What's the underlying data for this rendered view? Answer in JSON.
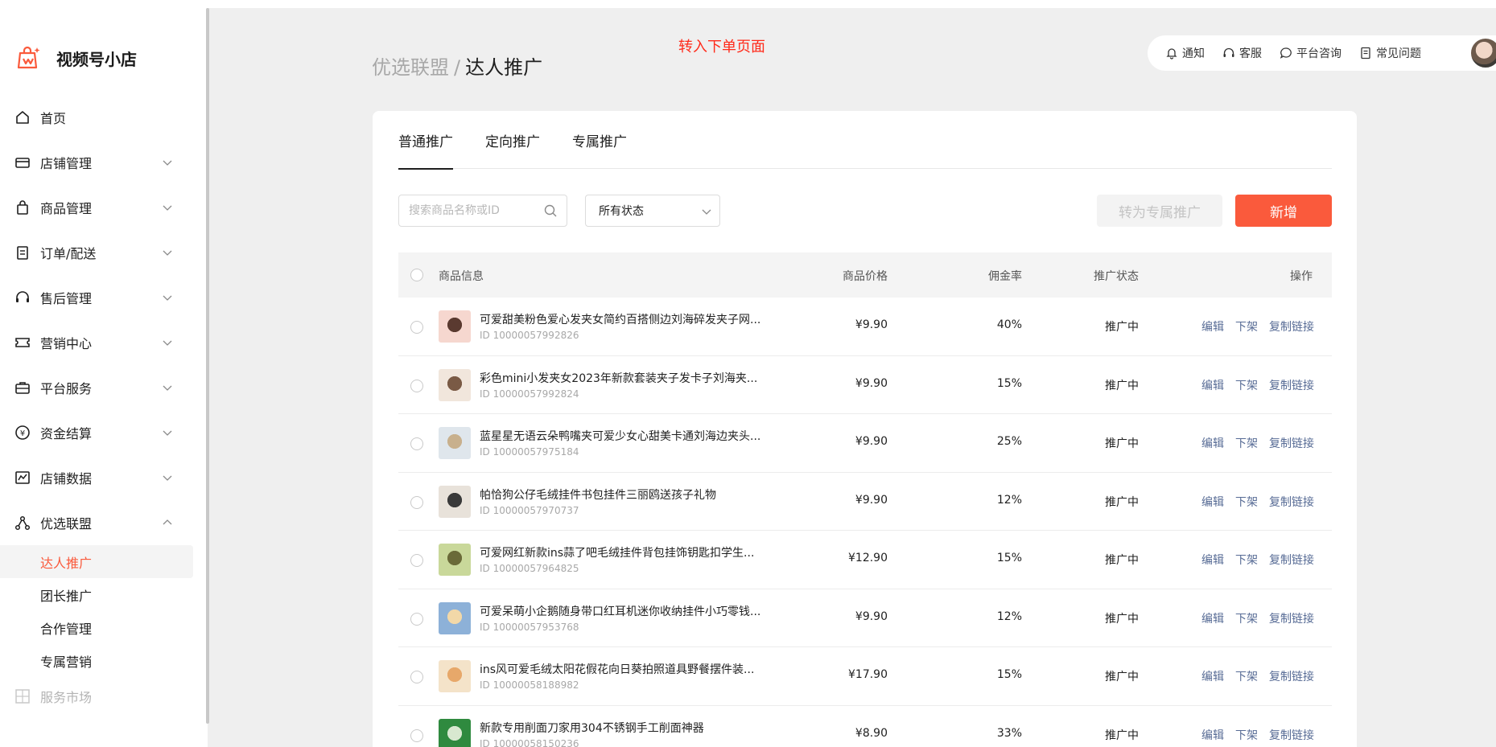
{
  "app": {
    "name": "视频号小店"
  },
  "sidebar": {
    "items": [
      {
        "label": "首页",
        "icon": "home-icon"
      },
      {
        "label": "店铺管理",
        "icon": "store-icon"
      },
      {
        "label": "商品管理",
        "icon": "bag-icon"
      },
      {
        "label": "订单/配送",
        "icon": "clipboard-icon"
      },
      {
        "label": "售后管理",
        "icon": "headset-icon"
      },
      {
        "label": "营销中心",
        "icon": "ticket-icon"
      },
      {
        "label": "平台服务",
        "icon": "briefcase-icon"
      },
      {
        "label": "资金结算",
        "icon": "yuan-icon"
      },
      {
        "label": "店铺数据",
        "icon": "chart-icon"
      },
      {
        "label": "优选联盟",
        "icon": "network-icon"
      }
    ],
    "sub_items": [
      "达人推广",
      "团长推广",
      "合作管理",
      "专属营销"
    ],
    "disabled_item": "服务市场"
  },
  "breadcrumb": {
    "parent": "优选联盟",
    "separator": "/",
    "current": "达人推广"
  },
  "annotation": "转入下单页面",
  "topbar": {
    "notify": "通知",
    "service": "客服",
    "consult": "平台咨询",
    "faq": "常见问题"
  },
  "tabs": [
    "普通推广",
    "定向推广",
    "专属推广"
  ],
  "search": {
    "placeholder": "搜索商品名称或ID",
    "value": ""
  },
  "status_select": {
    "value": "所有状态"
  },
  "buttons": {
    "convert": "转为专属推广",
    "add": "新增"
  },
  "accent_color": "#fa5a3c",
  "table": {
    "headers": {
      "info": "商品信息",
      "price": "商品价格",
      "commission": "佣金率",
      "status": "推广状态",
      "ops": "操作"
    },
    "op_labels": {
      "edit": "编辑",
      "delist": "下架",
      "copy": "复制链接"
    },
    "rows": [
      {
        "name": "可爱甜美粉色爱心发夹女简约百搭侧边刘海碎发夹子网...",
        "id": "ID 10000057992826",
        "price": "¥9.90",
        "commission": "40%",
        "status": "推广中"
      },
      {
        "name": "彩色mini小发夹女2023年新款套装夹子发卡子刘海夹...",
        "id": "ID 10000057992824",
        "price": "¥9.90",
        "commission": "15%",
        "status": "推广中"
      },
      {
        "name": "蓝星星无语云朵鸭嘴夹可爱少女心甜美卡通刘海边夹头...",
        "id": "ID 10000057975184",
        "price": "¥9.90",
        "commission": "25%",
        "status": "推广中"
      },
      {
        "name": "帕恰狗公仔毛绒挂件书包挂件三丽鸥送孩子礼物",
        "id": "ID 10000057970737",
        "price": "¥9.90",
        "commission": "12%",
        "status": "推广中"
      },
      {
        "name": "可爱网红新款ins蒜了吧毛绒挂件背包挂饰钥匙扣学生...",
        "id": "ID 10000057964825",
        "price": "¥12.90",
        "commission": "15%",
        "status": "推广中"
      },
      {
        "name": "可爱呆萌小企鹅随身带口红耳机迷你收纳挂件小巧零钱...",
        "id": "ID 10000057953768",
        "price": "¥9.90",
        "commission": "12%",
        "status": "推广中"
      },
      {
        "name": "ins风可爱毛绒太阳花假花向日葵拍照道具野餐摆件装...",
        "id": "ID 10000058188982",
        "price": "¥17.90",
        "commission": "15%",
        "status": "推广中"
      },
      {
        "name": "新款专用削面刀家用304不锈钢手工削面神器",
        "id": "ID 10000058150236",
        "price": "¥8.90",
        "commission": "33%",
        "status": "推广中"
      }
    ]
  }
}
